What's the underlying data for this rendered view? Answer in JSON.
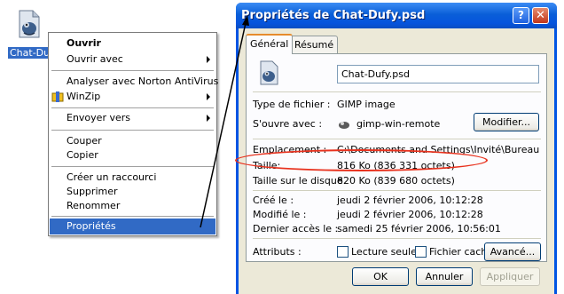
{
  "desktop": {
    "icon_label": "Chat-Duf"
  },
  "context_menu": {
    "items": [
      {
        "label": "Ouvrir"
      },
      {
        "label": "Ouvrir avec"
      },
      {
        "label": "Analyser avec Norton AntiVirus"
      },
      {
        "label": "WinZip"
      },
      {
        "label": "Envoyer vers"
      },
      {
        "label": "Couper"
      },
      {
        "label": "Copier"
      },
      {
        "label": "Créer un raccourci"
      },
      {
        "label": "Supprimer"
      },
      {
        "label": "Renommer"
      },
      {
        "label": "Propriétés"
      }
    ]
  },
  "dialog": {
    "title": "Propriétés de Chat-Dufy.psd",
    "help_label": "?",
    "close_label": "✕",
    "tabs": [
      {
        "label": "Général"
      },
      {
        "label": "Résumé"
      }
    ],
    "file_name": "Chat-Dufy.psd",
    "type_label": "Type de fichier :",
    "type_value": "GIMP image",
    "opens_label": "S'ouvre avec :",
    "opens_value": "gimp-win-remote",
    "modify_label": "Modifier...",
    "location_label": "Emplacement :",
    "location_value": "C:\\Documents and Settings\\Invité\\Bureau",
    "size_label": "Taille:",
    "size_value": "816 Ko (836 331 octets)",
    "disk_size_label": "Taille sur le disque",
    "disk_size_value": "820 Ko (839 680 octets)",
    "created_label": "Créé le :",
    "created_value": "jeudi 2 février 2006, 10:12:28",
    "modified_label": "Modifié le :",
    "modified_value": "jeudi 2 février 2006, 10:12:28",
    "accessed_label": "Dernier accès le :",
    "accessed_value": "samedi 25 février 2006, 10:56:01",
    "attributes_label": "Attributs :",
    "readonly_label": "Lecture seule",
    "hidden_label": "Fichier caché",
    "advanced_label": "Avancé...",
    "ok_label": "OK",
    "cancel_label": "Annuler",
    "apply_label": "Appliquer"
  },
  "colors": {
    "selection": "#316ac5",
    "annotation": "#e8321e",
    "titlebar": "#0a5fd8"
  }
}
